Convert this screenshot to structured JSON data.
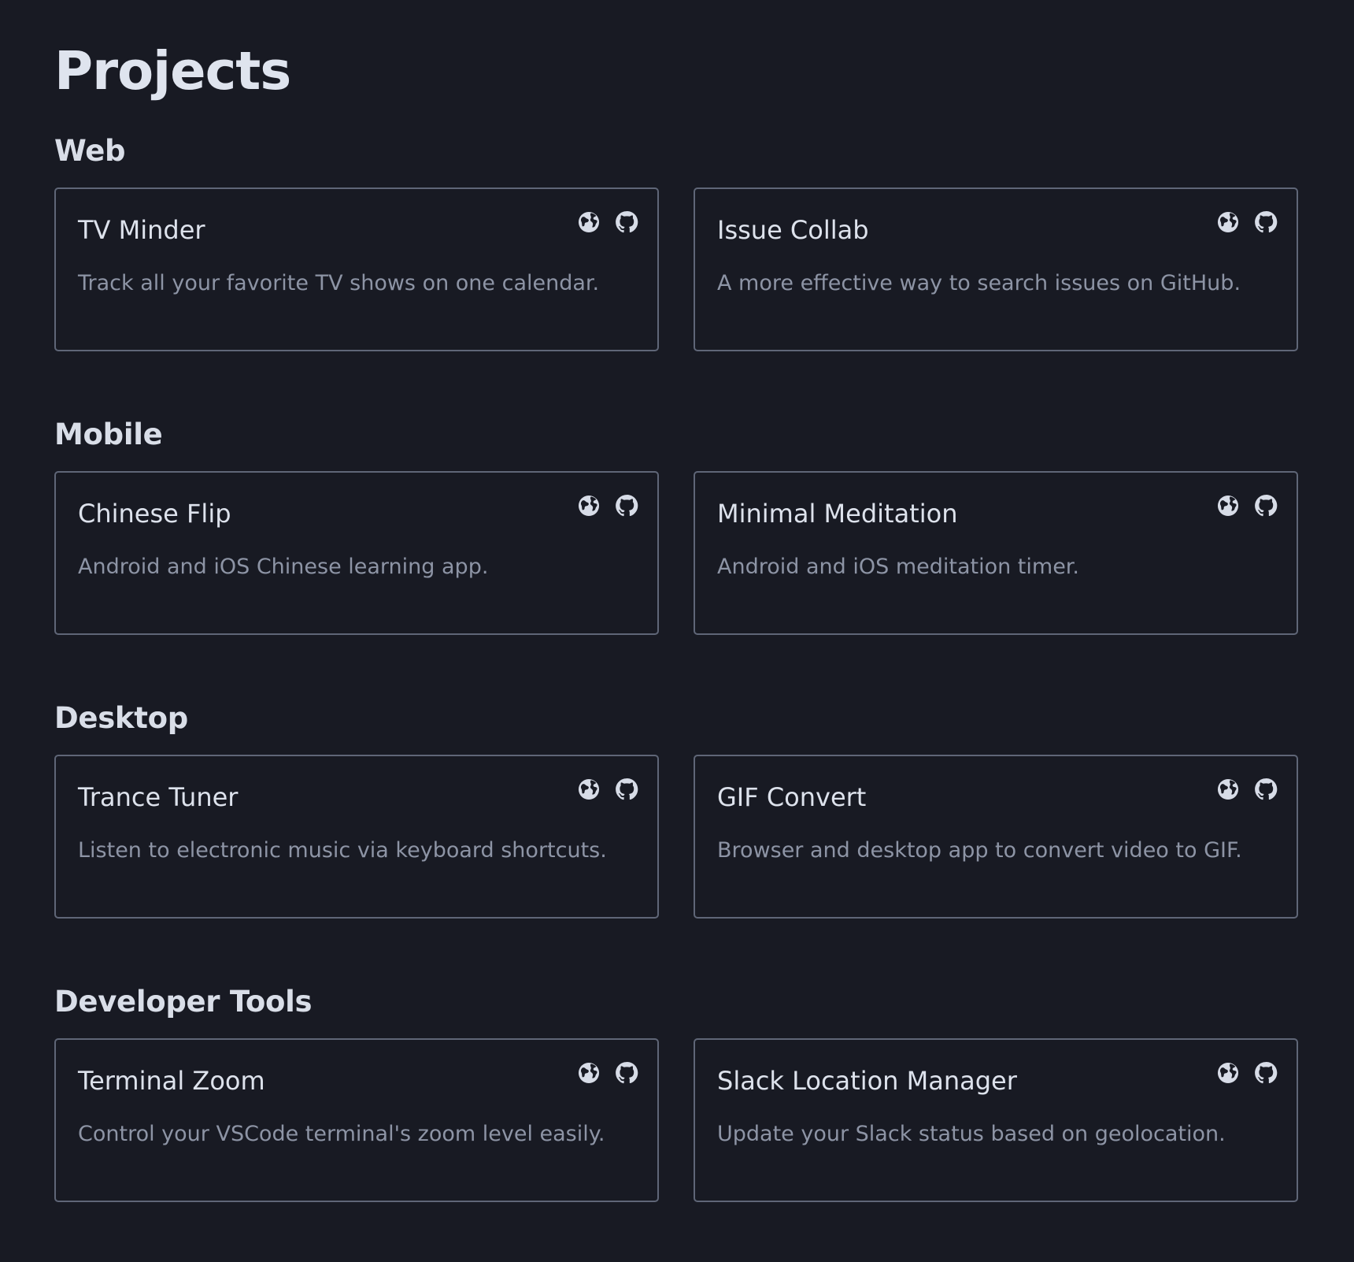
{
  "page": {
    "title": "Projects"
  },
  "sections": [
    {
      "title": "Web",
      "projects": [
        {
          "title": "TV Minder",
          "description": "Track all your favorite TV shows on one calendar.",
          "icons": [
            "globe-icon",
            "github-icon"
          ]
        },
        {
          "title": "Issue Collab",
          "description": "A more effective way to search issues on GitHub.",
          "icons": [
            "globe-icon",
            "github-icon"
          ]
        }
      ]
    },
    {
      "title": "Mobile",
      "projects": [
        {
          "title": "Chinese Flip",
          "description": "Android and iOS Chinese learning app.",
          "icons": [
            "globe-icon",
            "github-icon"
          ]
        },
        {
          "title": "Minimal Meditation",
          "description": "Android and iOS meditation timer.",
          "icons": [
            "globe-icon",
            "github-icon"
          ]
        }
      ]
    },
    {
      "title": "Desktop",
      "projects": [
        {
          "title": "Trance Tuner",
          "description": "Listen to electronic music via keyboard shortcuts.",
          "icons": [
            "globe-icon",
            "github-icon"
          ]
        },
        {
          "title": "GIF Convert",
          "description": "Browser and desktop app to convert video to GIF.",
          "icons": [
            "globe-icon",
            "github-icon"
          ]
        }
      ]
    },
    {
      "title": "Developer Tools",
      "projects": [
        {
          "title": "Terminal Zoom",
          "description": "Control your VSCode terminal's zoom level easily.",
          "icons": [
            "globe-icon",
            "github-icon"
          ]
        },
        {
          "title": "Slack Location Manager",
          "description": "Update your Slack status based on geolocation.",
          "icons": [
            "globe-icon",
            "github-icon"
          ]
        }
      ]
    }
  ],
  "colors": {
    "background": "#181a23",
    "title": "#dfe4ee",
    "muted_text": "#8d94a5",
    "card_border": "#5f6677",
    "icon": "#d7dce7"
  }
}
